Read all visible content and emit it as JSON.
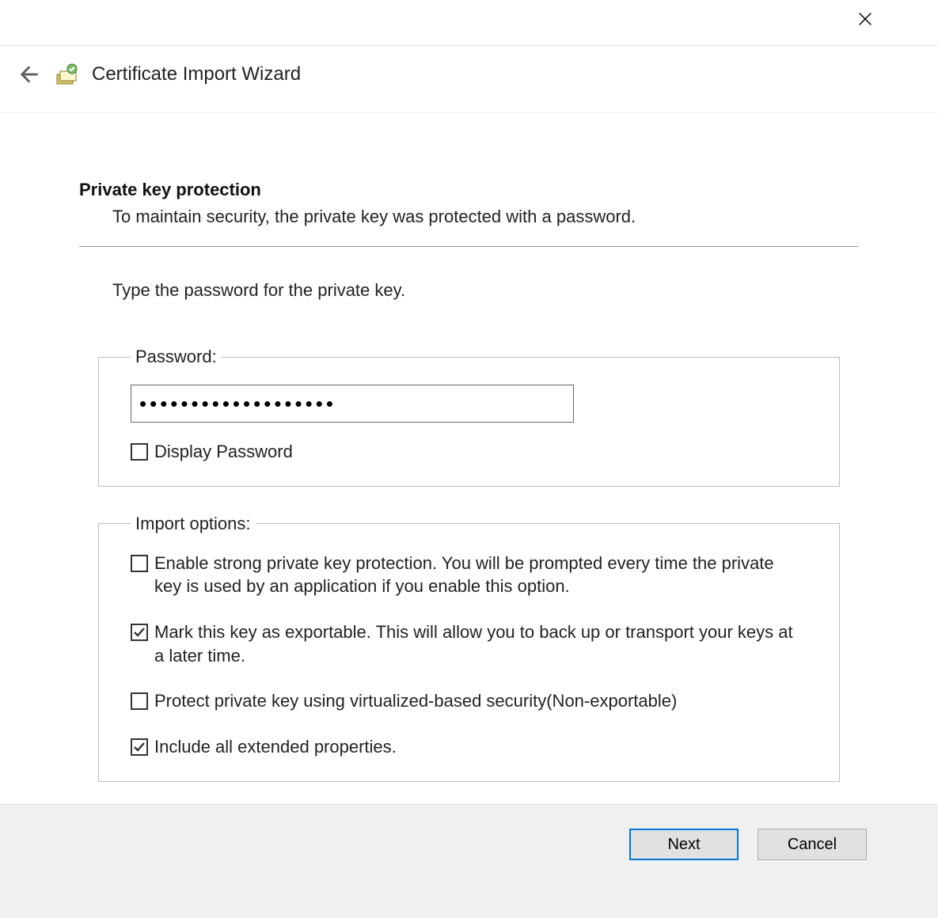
{
  "window": {
    "title": "Certificate Import Wizard"
  },
  "section": {
    "heading": "Private key protection",
    "description": "To maintain security, the private key was protected with a password.",
    "prompt": "Type the password for the private key."
  },
  "passwordGroup": {
    "legend": "Password:",
    "value_masked": "•••••••••••••••••••",
    "display_password_label": "Display Password",
    "display_password_checked": false
  },
  "importOptions": {
    "legend": "Import options:",
    "items": [
      {
        "label": "Enable strong private key protection. You will be prompted every time the private key is used by an application if you enable this option.",
        "checked": false
      },
      {
        "label": "Mark this key as exportable. This will allow you to back up or transport your keys at a later time.",
        "checked": true
      },
      {
        "label": "Protect private key using virtualized-based security(Non-exportable)",
        "checked": false
      },
      {
        "label": "Include all extended properties.",
        "checked": true
      }
    ]
  },
  "buttons": {
    "next": "Next",
    "cancel": "Cancel"
  }
}
